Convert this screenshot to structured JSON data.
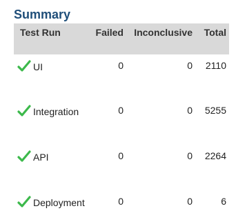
{
  "title": "Summary",
  "table": {
    "headers": {
      "test_run": "Test Run",
      "failed": "Failed",
      "inconclusive": "Inconclusive",
      "total": "Total"
    },
    "rows": [
      {
        "name": "UI",
        "failed": "0",
        "inconclusive": "0",
        "total": "2110",
        "status_icon": "check-icon"
      },
      {
        "name": "Integration",
        "failed": "0",
        "inconclusive": "0",
        "total": "5255",
        "status_icon": "check-icon"
      },
      {
        "name": "API",
        "failed": "0",
        "inconclusive": "0",
        "total": "2264",
        "status_icon": "check-icon"
      },
      {
        "name": "Deployment",
        "failed": "0",
        "inconclusive": "0",
        "total": "6",
        "status_icon": "check-icon"
      }
    ]
  },
  "colors": {
    "title": "#1f4e79",
    "header_bg": "#d9d9d9",
    "check": "#3cb94b"
  }
}
